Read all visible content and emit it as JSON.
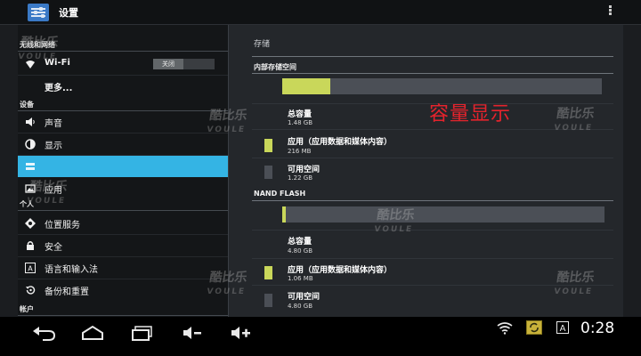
{
  "app": {
    "title": "设置"
  },
  "menu": {
    "sections": {
      "wireless": "无线和网络",
      "device": "设备",
      "personal": "个人",
      "account": "帐户"
    },
    "wifi": {
      "label": "Wi-Fi",
      "toggle": "关闭"
    },
    "items": {
      "more": "更多...",
      "sound": "声音",
      "display": "显示",
      "apps": "应用",
      "location": "位置服务",
      "security": "安全",
      "language": "语言和输入法",
      "backup": "备份和重置"
    }
  },
  "storage": {
    "title": "存储",
    "internal": {
      "header": "内部存储空间",
      "usage_fraction": 0.15,
      "total_label": "总容量",
      "total_value": "1.48 GB",
      "apps_label": "应用（应用数据和媒体内容）",
      "apps_value": "216 MB",
      "free_label": "可用空间",
      "free_value": "1.22 GB"
    },
    "nand": {
      "header": "NAND FLASH",
      "usage_fraction": 0.01,
      "total_label": "总容量",
      "total_value": "4.80 GB",
      "apps_label": "应用（应用数据和媒体内容）",
      "apps_value": "1.06 MB",
      "free_label": "可用空间",
      "free_value": "4.80 GB"
    }
  },
  "annotation": "容量显示",
  "watermark": {
    "mark": "酷比乐",
    "sub": "VOULE"
  },
  "status": {
    "time": "0:28"
  },
  "colors": {
    "accent": "#34b4e4",
    "apps_color": "#c9d75a",
    "free_color": "#4b4f56",
    "annotation": "#e4232c"
  }
}
